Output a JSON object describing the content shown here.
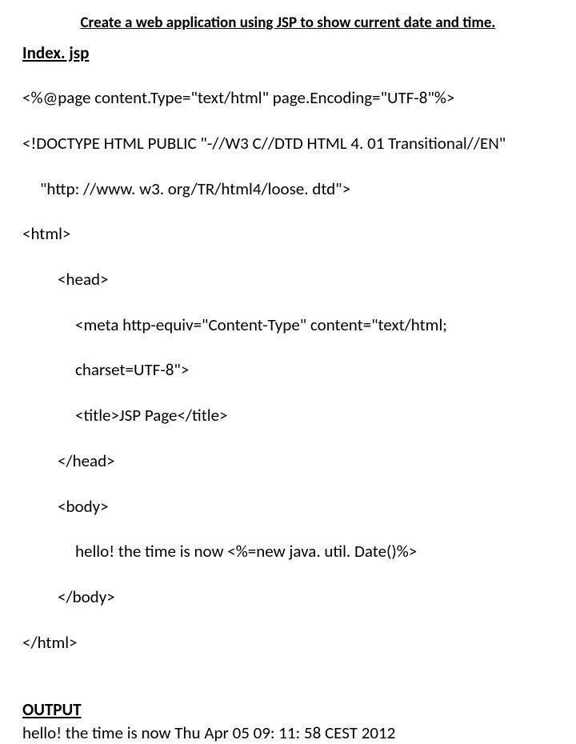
{
  "title": "Create a web application using JSP to show current date and time.",
  "filename": "Index. jsp",
  "code": {
    "l1": "<%@page content.Type=\"text/html\" page.Encoding=\"UTF-8\"%>",
    "l2": "<!DOCTYPE HTML PUBLIC \"-//W3 C//DTD HTML 4. 01 Transitional//EN\"",
    "l3": "\"http: //www. w3. org/TR/html4/loose. dtd\">",
    "l4": "<html>",
    "l5": "<head>",
    "l6": "<meta http-equiv=\"Content-Type\" content=\"text/html;",
    "l7": "charset=UTF-8\">",
    "l8": "<title>JSP Page</title>",
    "l9": "</head>",
    "l10": "<body>",
    "l11": "hello! the time is now <%=new java. util. Date()%>",
    "l12": "</body>",
    "l13": "</html>"
  },
  "output_heading": "OUTPUT",
  "output_text": "hello! the time is now Thu Apr 05 09: 11: 58 CEST 2012"
}
